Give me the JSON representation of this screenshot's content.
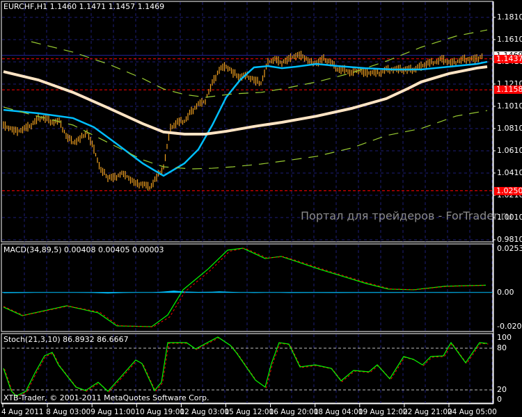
{
  "chart_data": [
    {
      "type": "line",
      "panel": "main",
      "title": "EURCHF,H1  1.1460 1.1471 1.1457 1.1469",
      "symbol": "EURCHF,H1",
      "ohlc_text": "1.1460 1.1471 1.1457 1.1469",
      "ylim": [
        0.981,
        1.1966
      ],
      "y_ticks": [
        "1.1810",
        "1.1610",
        "1.1410",
        "1.1210",
        "1.1010",
        "1.0810",
        "1.0610",
        "1.0410",
        "1.0210",
        "1.0010",
        "0.9810"
      ],
      "y_tick_values": [
        1.181,
        1.161,
        1.141,
        1.121,
        1.101,
        1.081,
        1.061,
        1.041,
        1.021,
        1.001,
        0.981
      ],
      "grid": true,
      "price_bars_close": [
        1.0841,
        1.081,
        1.0779,
        1.081,
        1.0841,
        1.0904,
        1.0904,
        1.0872,
        1.0872,
        1.0747,
        1.0685,
        1.0716,
        1.0779,
        1.0622,
        1.0435,
        1.0372,
        1.0372,
        1.0404,
        1.0372,
        1.031,
        1.031,
        1.0279,
        1.0372,
        1.0466,
        1.081,
        1.0872,
        1.0872,
        1.0966,
        1.1029,
        1.106,
        1.1216,
        1.1341,
        1.1372,
        1.131,
        1.1279,
        1.1279,
        1.1247,
        1.1216,
        1.1404,
        1.1435,
        1.1404,
        1.1435,
        1.1466,
        1.1466,
        1.1404,
        1.1404,
        1.1435,
        1.1404,
        1.1341,
        1.1341,
        1.131,
        1.1341,
        1.131,
        1.131,
        1.131,
        1.1341,
        1.1341,
        1.1341,
        1.1341,
        1.1341,
        1.1372,
        1.1404,
        1.1404,
        1.1435,
        1.1404,
        1.1404,
        1.1435,
        1.1435,
        1.1435,
        1.1466
      ],
      "series": [
        {
          "name": "MA fast",
          "color": "#00bfff",
          "points": [
            [
              0,
              1.0978
            ],
            [
              5,
              1.0947
            ],
            [
              10,
              1.0904
            ],
            [
              13,
              1.0822
            ],
            [
              16,
              1.0685
            ],
            [
              20,
              1.0497
            ],
            [
              23,
              1.0385
            ],
            [
              26,
              1.0497
            ],
            [
              28,
              1.0622
            ],
            [
              30,
              1.0841
            ],
            [
              32,
              1.1091
            ],
            [
              34,
              1.1247
            ],
            [
              36,
              1.136
            ],
            [
              38,
              1.1372
            ],
            [
              40,
              1.1353
            ],
            [
              42,
              1.1366
            ],
            [
              45,
              1.1391
            ],
            [
              48,
              1.1372
            ],
            [
              52,
              1.1353
            ],
            [
              56,
              1.1341
            ],
            [
              60,
              1.1341
            ],
            [
              64,
              1.1366
            ],
            [
              68,
              1.1391
            ],
            [
              69.5,
              1.141
            ]
          ]
        },
        {
          "name": "MA slow",
          "color": "#ffe4c4",
          "points": [
            [
              0,
              1.1322
            ],
            [
              5,
              1.1247
            ],
            [
              10,
              1.1135
            ],
            [
              15,
              1.0997
            ],
            [
              20,
              1.0854
            ],
            [
              23,
              1.0779
            ],
            [
              26,
              1.076
            ],
            [
              29,
              1.076
            ],
            [
              32,
              1.0785
            ],
            [
              36,
              1.0829
            ],
            [
              40,
              1.0866
            ],
            [
              45,
              1.0922
            ],
            [
              50,
              1.0991
            ],
            [
              55,
              1.1079
            ],
            [
              58,
              1.1166
            ],
            [
              60,
              1.1229
            ],
            [
              64,
              1.1304
            ],
            [
              68,
              1.1354
            ],
            [
              69.5,
              1.1366
            ]
          ]
        },
        {
          "name": "Envelope upper",
          "color": "#9acd32",
          "points": [
            [
              4,
              1.1591
            ],
            [
              10,
              1.1497
            ],
            [
              15,
              1.1391
            ],
            [
              20,
              1.126
            ],
            [
              23,
              1.1166
            ],
            [
              26,
              1.1116
            ],
            [
              29,
              1.1091
            ],
            [
              33,
              1.1122
            ],
            [
              37,
              1.1135
            ],
            [
              40,
              1.1166
            ],
            [
              45,
              1.1229
            ],
            [
              50,
              1.131
            ],
            [
              55,
              1.1416
            ],
            [
              60,
              1.1541
            ],
            [
              65,
              1.1641
            ],
            [
              69.5,
              1.1697
            ]
          ]
        },
        {
          "name": "Envelope lower",
          "color": "#9acd32",
          "points": [
            [
              0,
              1.1003
            ],
            [
              4,
              1.0935
            ],
            [
              10,
              1.0841
            ],
            [
              15,
              1.0685
            ],
            [
              20,
              1.0529
            ],
            [
              23,
              1.0466
            ],
            [
              27,
              1.0447
            ],
            [
              30,
              1.0453
            ],
            [
              33,
              1.0466
            ],
            [
              37,
              1.0491
            ],
            [
              40,
              1.0516
            ],
            [
              45,
              1.056
            ],
            [
              50,
              1.0635
            ],
            [
              55,
              1.0747
            ],
            [
              60,
              1.081
            ],
            [
              65,
              1.0922
            ],
            [
              69.5,
              1.0972
            ]
          ]
        }
      ],
      "price_levels": [
        {
          "label": "1.1469",
          "value": 1.1469,
          "kind": "bid"
        },
        {
          "label": "1.1437",
          "value": 1.1437,
          "kind": "level"
        },
        {
          "label": "1.1158",
          "value": 1.1158,
          "kind": "level"
        },
        {
          "label": "1.0250",
          "value": 1.025,
          "kind": "level"
        }
      ],
      "watermark": "Портал для трейдеров - ForTrader.ru"
    },
    {
      "type": "line",
      "panel": "macd",
      "title": "MACD(34,89,5) 0.00408 0.00405 0.00003",
      "ylim": [
        -0.02059,
        0.02534
      ],
      "y_ticks": [
        "0.02534",
        "0.00",
        "-0.02059"
      ],
      "series": [
        {
          "name": "MACD",
          "color": "#00ff00",
          "points": [
            [
              0,
              -0.0084
            ],
            [
              2.7,
              -0.0133
            ],
            [
              5.4,
              -0.0109
            ],
            [
              9.1,
              -0.0077
            ],
            [
              13.6,
              -0.0117
            ],
            [
              16.3,
              -0.0192
            ],
            [
              21.3,
              -0.0196
            ],
            [
              23.6,
              -0.0129
            ],
            [
              25.8,
              0.0015
            ],
            [
              29.4,
              0.0134
            ],
            [
              32.2,
              0.0242
            ],
            [
              34.4,
              0.0253
            ],
            [
              37.6,
              0.0194
            ],
            [
              39.9,
              0.0206
            ],
            [
              42.6,
              0.017
            ],
            [
              45.3,
              0.0134
            ],
            [
              48.9,
              0.009
            ],
            [
              52.1,
              0.0051
            ],
            [
              55.3,
              0.0019
            ],
            [
              58.9,
              0.0015
            ],
            [
              63.4,
              0.0035
            ],
            [
              69.3,
              0.0041
            ]
          ]
        },
        {
          "name": "Signal",
          "color": "#ff0000",
          "points": [
            [
              0,
              -0.008
            ],
            [
              2.9,
              -0.0132
            ],
            [
              5.6,
              -0.011
            ],
            [
              9.3,
              -0.0078
            ],
            [
              13.8,
              -0.0113
            ],
            [
              16.5,
              -0.019
            ],
            [
              21.5,
              -0.0198
            ],
            [
              23.9,
              -0.014
            ],
            [
              26.1,
              0.0005
            ],
            [
              29.7,
              0.0125
            ],
            [
              32.5,
              0.0236
            ],
            [
              34.7,
              0.0253
            ],
            [
              37.9,
              0.0196
            ],
            [
              40.2,
              0.0205
            ],
            [
              42.9,
              0.0172
            ],
            [
              45.6,
              0.0136
            ],
            [
              49.2,
              0.0092
            ],
            [
              52.4,
              0.0053
            ],
            [
              55.6,
              0.002
            ],
            [
              59.2,
              0.0015
            ],
            [
              63.7,
              0.0034
            ],
            [
              69.3,
              0.004
            ]
          ]
        },
        {
          "name": "Histogram",
          "color": "#00bfff",
          "points": [
            [
              0,
              -0.0004
            ],
            [
              3,
              -0.0003
            ],
            [
              6,
              0.0001
            ],
            [
              9,
              0.0
            ],
            [
              12,
              -0.0002
            ],
            [
              15,
              -0.0006
            ],
            [
              18,
              -0.0002
            ],
            [
              21,
              0.0
            ],
            [
              23,
              0.0005
            ],
            [
              24.5,
              0.001
            ],
            [
              26,
              0.0005
            ],
            [
              28,
              0.0003
            ],
            [
              30,
              0.0004
            ],
            [
              31,
              0.0006
            ],
            [
              33,
              0.0003
            ],
            [
              36,
              -0.0003
            ],
            [
              39,
              0.0
            ],
            [
              41,
              -0.0003
            ],
            [
              45,
              -0.0002
            ],
            [
              48,
              -0.0003
            ],
            [
              52,
              -0.0002
            ],
            [
              56,
              -0.0002
            ],
            [
              60,
              -0.0001
            ],
            [
              64,
              -0.0002
            ],
            [
              69,
              0.0
            ]
          ]
        }
      ]
    },
    {
      "type": "line",
      "panel": "stochastic",
      "title": "Stoch(21,3,10) 86.8932 86.6667",
      "ylim": [
        0,
        100
      ],
      "y_ticks": [
        "100",
        "80",
        "20",
        "0"
      ],
      "levels": [
        80,
        20
      ],
      "series": [
        {
          "name": "%K",
          "color": "#00ff00",
          "points": [
            [
              0,
              51
            ],
            [
              1.1,
              19
            ],
            [
              1.8,
              11
            ],
            [
              3.2,
              18
            ],
            [
              4.5,
              44
            ],
            [
              5.9,
              69
            ],
            [
              7,
              74
            ],
            [
              7.9,
              56
            ],
            [
              10.4,
              24
            ],
            [
              11.8,
              19
            ],
            [
              13.6,
              31
            ],
            [
              15,
              18
            ],
            [
              16.8,
              38
            ],
            [
              19,
              63
            ],
            [
              19.9,
              58
            ],
            [
              21.7,
              19
            ],
            [
              22.7,
              31
            ],
            [
              23.6,
              88
            ],
            [
              26.3,
              88
            ],
            [
              27.6,
              79
            ],
            [
              30.8,
              96
            ],
            [
              32.6,
              84
            ],
            [
              33.5,
              73
            ],
            [
              36.2,
              34
            ],
            [
              37.6,
              24
            ],
            [
              38.5,
              58
            ],
            [
              39.6,
              88
            ],
            [
              41,
              86
            ],
            [
              42.6,
              53
            ],
            [
              44.8,
              56
            ],
            [
              47.1,
              51
            ],
            [
              48.5,
              33
            ],
            [
              50.3,
              48
            ],
            [
              52.5,
              46
            ],
            [
              53.7,
              56
            ],
            [
              55.5,
              36
            ],
            [
              57.5,
              68
            ],
            [
              58.9,
              64
            ],
            [
              60.2,
              56
            ],
            [
              61.4,
              68
            ],
            [
              63.2,
              69
            ],
            [
              64.3,
              88
            ],
            [
              66.4,
              59
            ],
            [
              68.4,
              88
            ],
            [
              69.5,
              86.9
            ]
          ]
        }
      ]
    }
  ],
  "time_axis": [
    "4 Aug 2011",
    "8 Aug 03:00",
    "9 Aug 11:00",
    "10 Aug 19:00",
    "12 Aug 03:00",
    "15 Aug 12:00",
    "16 Aug 20:00",
    "18 Aug 04:00",
    "19 Aug 12:00",
    "22 Aug 21:00",
    "24 Aug 05:00"
  ],
  "copyright": "XTB-Trader, © 2001-2011 MetaQuotes Software Corp."
}
